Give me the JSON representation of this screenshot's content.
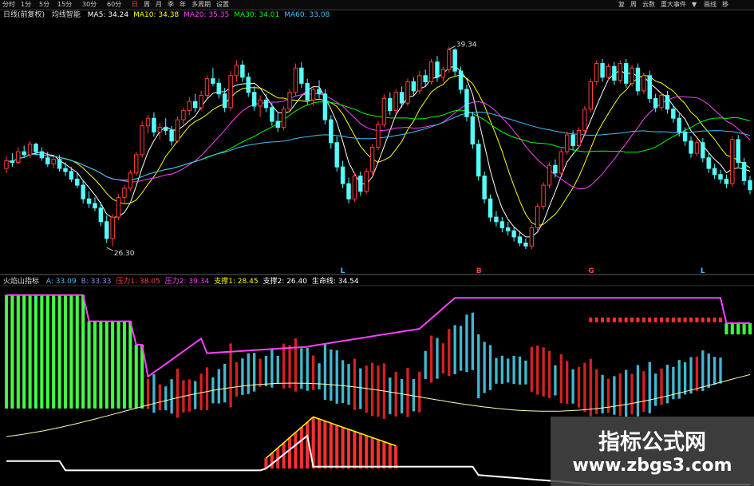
{
  "toolbar": {
    "left": [
      "分时",
      "1分",
      "5分",
      "15分",
      "30分",
      "60分",
      "日",
      "周",
      "月",
      "季",
      "年",
      "多周期",
      "设置"
    ],
    "active": "日",
    "right": [
      "复",
      "周",
      "云数",
      "重大事件",
      "▼",
      "画线",
      "移"
    ]
  },
  "main_header": {
    "title": "日线(前复权)",
    "indicator": "均线智能",
    "items": [
      {
        "label": "MA5:",
        "value": "34.24",
        "color": "#ffffff"
      },
      {
        "label": "MA10:",
        "value": "34.38",
        "color": "#ffff00"
      },
      {
        "label": "MA20:",
        "value": "35.35",
        "color": "#ff40ff"
      },
      {
        "label": "MA30:",
        "value": "34.01",
        "color": "#00ff00"
      },
      {
        "label": "MA60:",
        "value": "33.08",
        "color": "#40c0ff"
      }
    ]
  },
  "sub_header": {
    "title": "火焰山指标",
    "items": [
      {
        "label": "A:",
        "value": "33.09",
        "color": "#40c0ff"
      },
      {
        "label": "B:",
        "value": "33.33",
        "color": "#8888ff"
      },
      {
        "label": "压力1:",
        "value": "38.05",
        "color": "#ff4040"
      },
      {
        "label": "压力2:",
        "value": "39.34",
        "color": "#ff40ff"
      },
      {
        "label": "支撑1:",
        "value": "28.45",
        "color": "#ffff00"
      },
      {
        "label": "支撑2:",
        "value": "26.40",
        "color": "#ffffff"
      },
      {
        "label": "生命线:",
        "value": "34.54",
        "color": "#ffffff"
      }
    ]
  },
  "chart_data": [
    {
      "type": "candlestick",
      "panel": "main",
      "ohlc": [
        [
          31.5,
          32.3,
          31.2,
          32.0
        ],
        [
          32.0,
          32.5,
          31.6,
          31.9
        ],
        [
          31.9,
          32.9,
          31.8,
          32.6
        ],
        [
          32.6,
          33.0,
          32.2,
          32.4
        ],
        [
          32.4,
          33.3,
          32.2,
          33.1
        ],
        [
          33.1,
          33.2,
          32.4,
          32.6
        ],
        [
          32.6,
          32.9,
          32.0,
          32.2
        ],
        [
          32.2,
          32.6,
          31.6,
          31.8
        ],
        [
          31.8,
          32.3,
          31.5,
          32.1
        ],
        [
          32.1,
          32.4,
          31.3,
          31.5
        ],
        [
          31.5,
          31.9,
          31.0,
          31.3
        ],
        [
          31.3,
          31.6,
          30.6,
          30.8
        ],
        [
          30.8,
          31.2,
          30.2,
          30.4
        ],
        [
          30.4,
          30.7,
          29.2,
          29.5
        ],
        [
          29.5,
          30.0,
          28.9,
          29.2
        ],
        [
          29.2,
          29.6,
          28.7,
          28.9
        ],
        [
          28.9,
          29.3,
          27.7,
          28.0
        ],
        [
          28.0,
          28.4,
          26.6,
          26.9
        ],
        [
          26.9,
          28.5,
          26.4,
          28.3
        ],
        [
          28.3,
          29.8,
          28.1,
          29.6
        ],
        [
          29.6,
          30.4,
          29.2,
          30.2
        ],
        [
          30.2,
          31.4,
          30.0,
          31.2
        ],
        [
          31.2,
          32.6,
          31.0,
          32.4
        ],
        [
          32.4,
          34.6,
          32.2,
          34.3
        ],
        [
          34.3,
          35.0,
          33.8,
          34.8
        ],
        [
          34.8,
          35.2,
          33.6,
          33.9
        ],
        [
          33.9,
          34.5,
          33.4,
          34.2
        ],
        [
          34.2,
          34.8,
          33.7,
          34.0
        ],
        [
          34.0,
          34.3,
          33.0,
          33.3
        ],
        [
          33.3,
          34.9,
          33.2,
          34.7
        ],
        [
          34.7,
          35.5,
          34.4,
          35.3
        ],
        [
          35.3,
          36.2,
          35.0,
          35.9
        ],
        [
          35.9,
          36.4,
          35.2,
          35.5
        ],
        [
          35.5,
          36.6,
          35.3,
          36.3
        ],
        [
          36.3,
          37.6,
          36.1,
          37.4
        ],
        [
          37.4,
          38.1,
          36.9,
          37.1
        ],
        [
          37.1,
          37.4,
          36.1,
          36.4
        ],
        [
          36.4,
          36.8,
          35.2,
          35.5
        ],
        [
          35.5,
          37.9,
          35.3,
          37.6
        ],
        [
          37.6,
          38.6,
          37.2,
          38.3
        ],
        [
          38.3,
          38.6,
          37.2,
          37.5
        ],
        [
          37.5,
          37.8,
          36.2,
          36.5
        ],
        [
          36.5,
          36.9,
          35.3,
          35.6
        ],
        [
          35.6,
          36.3,
          34.9,
          36.0
        ],
        [
          36.0,
          36.4,
          35.2,
          35.5
        ],
        [
          35.5,
          35.8,
          34.3,
          34.6
        ],
        [
          34.6,
          35.2,
          33.9,
          34.2
        ],
        [
          34.2,
          35.6,
          34.0,
          35.4
        ],
        [
          35.4,
          36.7,
          35.2,
          36.5
        ],
        [
          36.5,
          38.4,
          36.3,
          38.1
        ],
        [
          38.1,
          38.5,
          36.8,
          37.1
        ],
        [
          37.1,
          37.4,
          35.7,
          36.0
        ],
        [
          36.0,
          36.9,
          35.6,
          36.7
        ],
        [
          36.7,
          37.3,
          36.1,
          36.4
        ],
        [
          36.4,
          36.7,
          34.4,
          34.7
        ],
        [
          34.7,
          35.0,
          32.8,
          33.2
        ],
        [
          33.2,
          33.6,
          31.3,
          31.6
        ],
        [
          31.6,
          32.0,
          30.2,
          30.5
        ],
        [
          30.5,
          30.9,
          29.2,
          29.5
        ],
        [
          29.5,
          31.2,
          29.3,
          31.0
        ],
        [
          31.0,
          31.3,
          29.7,
          30.0
        ],
        [
          30.0,
          31.5,
          29.8,
          31.3
        ],
        [
          31.3,
          33.1,
          31.1,
          32.9
        ],
        [
          32.9,
          34.6,
          32.7,
          34.4
        ],
        [
          34.4,
          36.4,
          34.2,
          36.1
        ],
        [
          36.1,
          36.5,
          35.0,
          35.3
        ],
        [
          35.3,
          36.7,
          35.1,
          36.5
        ],
        [
          36.5,
          36.9,
          35.5,
          35.8
        ],
        [
          35.8,
          37.4,
          35.6,
          37.2
        ],
        [
          37.2,
          37.5,
          36.3,
          36.6
        ],
        [
          36.6,
          37.9,
          36.4,
          37.6
        ],
        [
          37.6,
          38.0,
          36.9,
          37.2
        ],
        [
          37.2,
          38.7,
          37.0,
          38.5
        ],
        [
          38.5,
          38.9,
          37.2,
          37.5
        ],
        [
          37.5,
          38.2,
          37.2,
          38.0
        ],
        [
          38.0,
          39.5,
          37.8,
          39.3
        ],
        [
          39.3,
          39.4,
          37.6,
          37.9
        ],
        [
          37.9,
          38.2,
          36.4,
          36.7
        ],
        [
          36.7,
          37.0,
          34.6,
          34.9
        ],
        [
          34.9,
          35.2,
          32.8,
          33.1
        ],
        [
          33.1,
          33.4,
          30.7,
          31.0
        ],
        [
          31.0,
          31.3,
          29.2,
          29.5
        ],
        [
          29.5,
          29.8,
          28.0,
          28.3
        ],
        [
          28.3,
          28.7,
          27.7,
          28.0
        ],
        [
          28.0,
          28.3,
          27.3,
          27.6
        ],
        [
          27.6,
          28.0,
          27.1,
          27.4
        ],
        [
          27.4,
          27.7,
          26.7,
          27.0
        ],
        [
          27.0,
          27.4,
          26.4,
          26.6
        ],
        [
          26.6,
          26.9,
          26.2,
          26.4
        ],
        [
          26.4,
          27.8,
          26.2,
          27.6
        ],
        [
          27.6,
          29.2,
          27.4,
          29.0
        ],
        [
          29.0,
          30.6,
          28.8,
          30.4
        ],
        [
          30.4,
          31.9,
          30.2,
          31.7
        ],
        [
          31.7,
          32.1,
          30.9,
          31.2
        ],
        [
          31.2,
          32.8,
          31.0,
          32.6
        ],
        [
          32.6,
          33.9,
          32.4,
          33.7
        ],
        [
          33.7,
          34.0,
          32.7,
          33.0
        ],
        [
          33.0,
          34.2,
          32.8,
          34.0
        ],
        [
          34.0,
          35.6,
          33.8,
          35.4
        ],
        [
          35.4,
          37.4,
          35.2,
          37.2
        ],
        [
          37.2,
          38.6,
          37.0,
          38.4
        ],
        [
          38.4,
          38.7,
          37.2,
          37.5
        ],
        [
          37.5,
          38.4,
          37.3,
          38.2
        ],
        [
          38.2,
          38.5,
          37.0,
          37.3
        ],
        [
          37.3,
          38.6,
          37.1,
          38.4
        ],
        [
          38.4,
          38.7,
          36.8,
          37.1
        ],
        [
          37.1,
          38.3,
          36.9,
          38.1
        ],
        [
          38.1,
          38.4,
          36.3,
          36.6
        ],
        [
          36.6,
          37.8,
          36.4,
          37.6
        ],
        [
          37.6,
          37.9,
          35.8,
          36.1
        ],
        [
          36.1,
          36.4,
          35.2,
          35.5
        ],
        [
          35.5,
          36.5,
          35.3,
          36.3
        ],
        [
          36.3,
          36.6,
          35.1,
          35.4
        ],
        [
          35.4,
          35.7,
          34.5,
          34.8
        ],
        [
          34.8,
          35.1,
          33.6,
          33.9
        ],
        [
          33.9,
          34.2,
          33.0,
          33.3
        ],
        [
          33.3,
          33.6,
          32.2,
          32.5
        ],
        [
          32.5,
          33.4,
          32.3,
          33.2
        ],
        [
          33.2,
          33.5,
          31.9,
          32.2
        ],
        [
          32.2,
          32.5,
          31.2,
          31.5
        ],
        [
          31.5,
          31.8,
          30.8,
          31.1
        ],
        [
          31.1,
          31.4,
          30.5,
          30.8
        ],
        [
          30.8,
          31.1,
          30.2,
          30.5
        ],
        [
          30.5,
          33.6,
          30.3,
          33.4
        ],
        [
          33.4,
          33.7,
          31.6,
          31.9
        ],
        [
          31.9,
          32.2,
          30.4,
          30.7
        ],
        [
          30.7,
          31.0,
          29.8,
          30.1
        ]
      ],
      "moving_averages": [
        {
          "name": "MA5",
          "period": 5,
          "color": "#ffffff"
        },
        {
          "name": "MA10",
          "period": 10,
          "color": "#ffff00"
        },
        {
          "name": "MA20",
          "period": 20,
          "color": "#ff40ff"
        },
        {
          "name": "MA30",
          "period": 30,
          "color": "#00ff00"
        },
        {
          "name": "MA60",
          "period": 60,
          "color": "#40c0ff"
        }
      ],
      "annotations": [
        {
          "text": "39.34",
          "x": 75,
          "y": 39.34
        },
        {
          "text": "26.30",
          "x": 17,
          "y": 26.3
        }
      ],
      "markers": [
        {
          "text": "L",
          "x": 57,
          "color": "#40c0ff"
        },
        {
          "text": "B",
          "x": 80,
          "color": "#ff4040"
        },
        {
          "text": "G",
          "x": 99,
          "color": "#ff4040"
        },
        {
          "text": "L",
          "x": 118,
          "color": "#40c0ff"
        }
      ]
    },
    {
      "type": "line",
      "panel": "sub",
      "series": [
        {
          "name": "压力2",
          "color": "#ff40ff"
        },
        {
          "name": "生命线",
          "color": "#ffffb0"
        },
        {
          "name": "支撑2",
          "color": "#ffffff"
        },
        {
          "name": "支撑1",
          "color": "#ffff00"
        }
      ],
      "fills": [
        {
          "name": "green-zone",
          "color": "#40ff40"
        },
        {
          "name": "red-zone",
          "color": "#ff3030"
        }
      ]
    }
  ],
  "watermark": {
    "line1": "指标公式网",
    "line2": "www.zbgs3.com"
  }
}
